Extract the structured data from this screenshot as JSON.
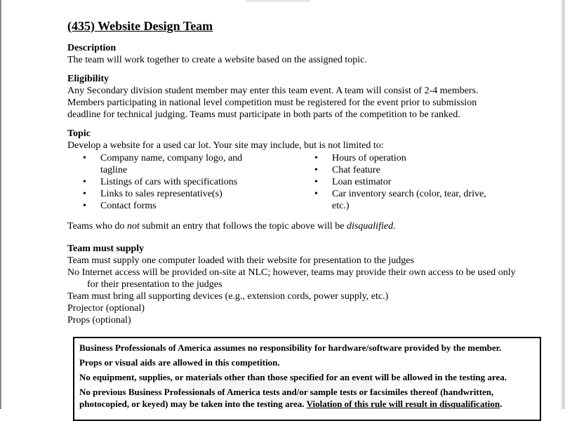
{
  "event": {
    "title": "(435) Website Design Team"
  },
  "description": {
    "heading": "Description",
    "text": "The team will work together to create a website based on the assigned topic."
  },
  "eligibility": {
    "heading": "Eligibility",
    "lines": [
      "Any Secondary division student member may enter this team event. A team will consist of 2-4 members.",
      "Members participating in national level competition must be registered for the event prior to submission",
      "deadline for technical judging.  Teams must participate in both parts of the competition to be ranked."
    ]
  },
  "topic": {
    "heading": "Topic",
    "intro": "Develop a website for a used car lot. Your site may include, but is not limited to:",
    "bullet_glyph": "•",
    "left_items": [
      "Company name, company logo, and tagline",
      "Listings of cars with specifications",
      "Links to sales representative(s)",
      "Contact forms"
    ],
    "right_items": [
      "Hours of operation",
      "Chat feature",
      "Loan estimator",
      "Car inventory search (color, tear, drive, etc.)"
    ],
    "warning_pre": "Teams who do ",
    "warning_em": "not",
    "warning_mid": " submit an entry that follows the topic above will be ",
    "warning_em2": "disqualified",
    "warning_post": "."
  },
  "supply": {
    "heading": "Team must supply",
    "lines": [
      "Team must supply one computer loaded with their website for presentation to the judges",
      "No Internet access will be provided on-site at NLC; however, teams may provide their own access to be used only for their presentation to the judges",
      "Team must bring all supporting devices (e.g., extension cords, power supply, etc.)",
      "Projector (optional)",
      "Props (optional)"
    ]
  },
  "notice": {
    "line1": "Business Professionals of America assumes no responsibility for hardware/software provided by the member.",
    "line2": "Props or visual aids are allowed in this competition.",
    "line3": "No equipment, supplies, or materials other than those specified for an event will be allowed in the testing area.",
    "line4_pre": "No previous Business Professionals of America tests and/or sample tests or facsimiles thereof (handwritten, photocopied, or keyed) may be taken into the testing area.  ",
    "line4_underlined": "Violation of this rule will result in disqualification",
    "line4_post": "."
  }
}
